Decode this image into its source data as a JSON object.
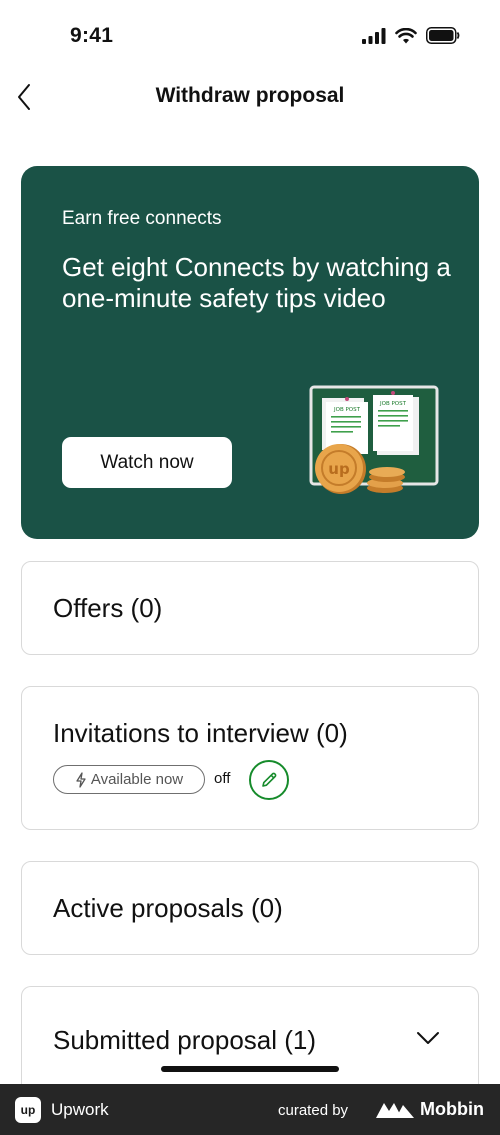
{
  "status_bar": {
    "time": "9:41"
  },
  "nav": {
    "title": "Withdraw proposal"
  },
  "promo": {
    "eyebrow": "Earn free connects",
    "headline": "Get eight Connects by watching a one-minute safety tips video",
    "button_label": "Watch now",
    "illustration": {
      "left_card": "JOB POST",
      "right_card": "JOB POST",
      "coin": "up"
    }
  },
  "sections": {
    "offers": "Offers  (0)",
    "invitations": {
      "title": "Invitations to interview (0)",
      "availability_label": "Available now",
      "availability_state": "off"
    },
    "active": "Active proposals  (0)",
    "submitted": "Submitted proposal  (1)"
  },
  "footer": {
    "app_name": "Upwork",
    "logo_text": "up",
    "curated_by": "curated by",
    "brand": "Mobbin"
  },
  "colors": {
    "promo_bg": "#1a5246",
    "accent_green": "#168b2b",
    "footer_bg": "#262626"
  },
  "icons": [
    "signal-icon",
    "wifi-icon",
    "battery-icon",
    "back-chevron-icon",
    "lightning-icon",
    "pencil-icon",
    "chevron-down-icon",
    "mobbin-logo-icon"
  ]
}
